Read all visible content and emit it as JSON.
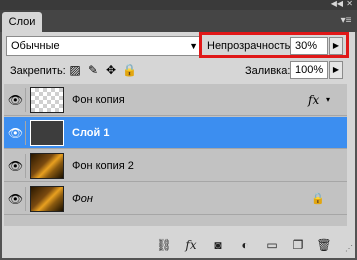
{
  "window": {
    "collapse_icon": "double-chevron-left-icon",
    "close_icon": "close-icon"
  },
  "tabs": [
    {
      "label": "Слои"
    }
  ],
  "panel_menu_icon": "panel-menu-icon",
  "blend_mode": {
    "value": "Обычные"
  },
  "opacity": {
    "label": "Непрозрачность:",
    "value": "30%"
  },
  "lock": {
    "label": "Закрепить:",
    "icons": [
      "lock-transparency-icon",
      "lock-image-icon",
      "lock-position-icon",
      "lock-all-icon"
    ]
  },
  "fill": {
    "label": "Заливка:",
    "value": "100%"
  },
  "layers": [
    {
      "name": "Фон копия",
      "thumb": "transparent",
      "visible": true,
      "has_fx": true,
      "selected": false,
      "locked": false
    },
    {
      "name": "Слой 1",
      "thumb": "dark",
      "visible": true,
      "has_fx": false,
      "selected": true,
      "locked": false
    },
    {
      "name": "Фон копия 2",
      "thumb": "photo",
      "visible": true,
      "has_fx": false,
      "selected": false,
      "locked": false
    },
    {
      "name": "Фон",
      "thumb": "photo",
      "visible": true,
      "has_fx": false,
      "selected": false,
      "locked": true
    }
  ],
  "fx_label": "fx",
  "bottom_toolbar": [
    "link-layers-icon",
    "layer-style-icon",
    "add-mask-icon",
    "adjustment-layer-icon",
    "new-group-icon",
    "new-layer-icon",
    "delete-layer-icon"
  ],
  "colors": {
    "selected_row": "#3c8ef0",
    "highlight": "#e01818"
  }
}
